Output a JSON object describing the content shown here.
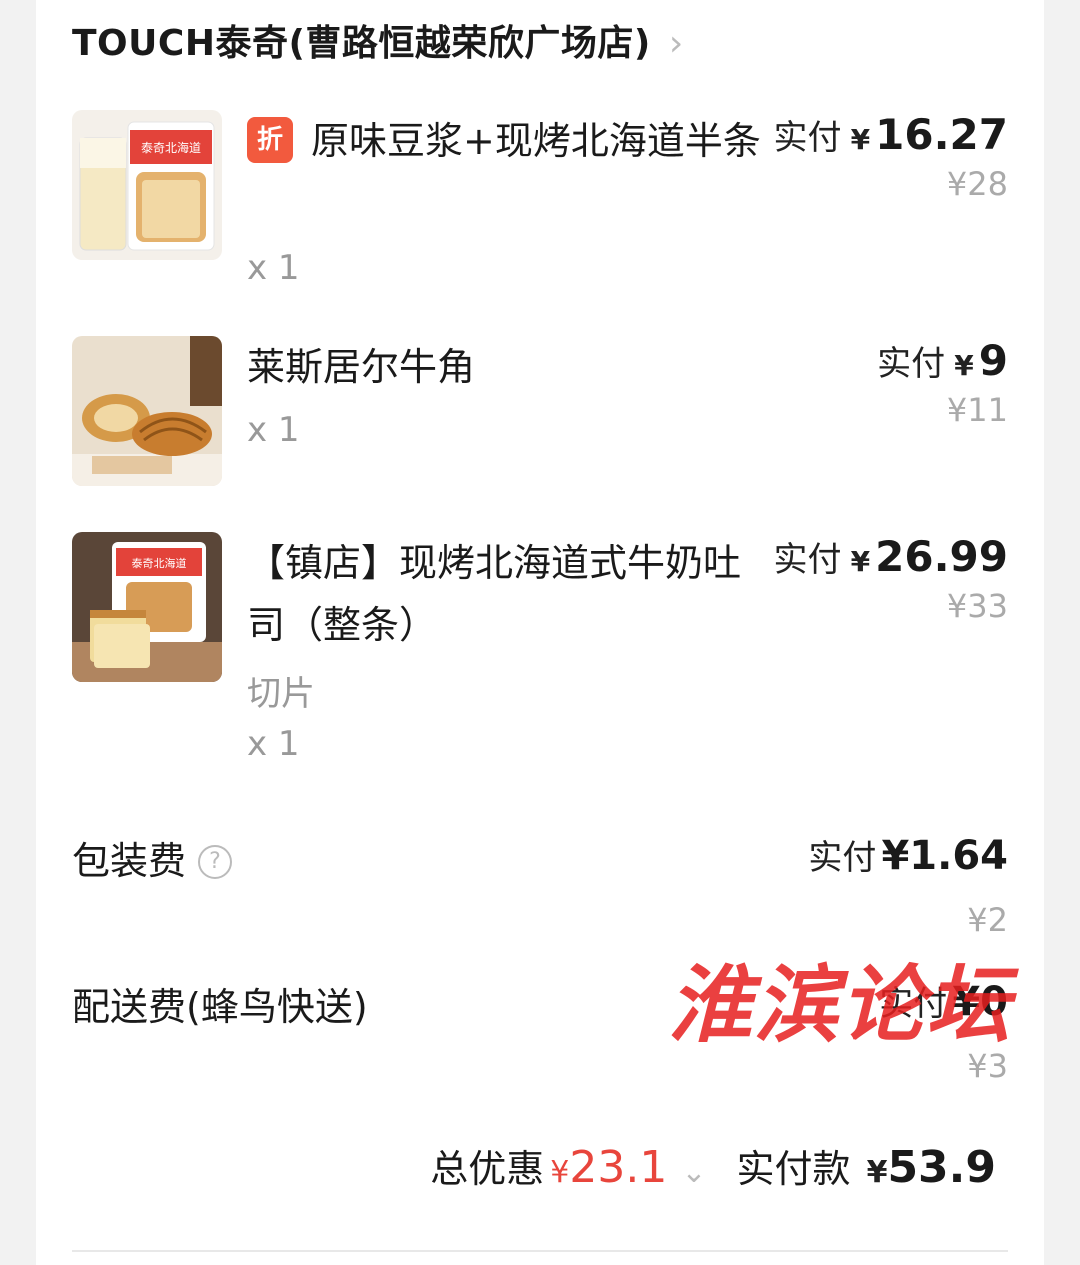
{
  "store": {
    "name": "TOUCH泰奇(曹路恒越荣欣广场店)",
    "chevron": "›"
  },
  "labels": {
    "paid": "实付",
    "currency": "¥",
    "discount_badge": "折"
  },
  "items": [
    {
      "name": "原味豆浆+现烤北海道半条",
      "qty": "x 1",
      "paid": "16.27",
      "original": "¥28",
      "has_discount": true,
      "spec": ""
    },
    {
      "name": "莱斯居尔牛角",
      "qty": "x 1",
      "paid": "9",
      "original": "¥11",
      "has_discount": false,
      "spec": ""
    },
    {
      "name": "【镇店】现烤北海道式牛奶吐司（整条）",
      "qty": "x 1",
      "paid": "26.99",
      "original": "¥33",
      "has_discount": false,
      "spec": "切片"
    }
  ],
  "fees": [
    {
      "label": "包装费",
      "paid_label": "实付",
      "paid": "¥1.64",
      "original": "¥2",
      "help": "?"
    },
    {
      "label": "配送费(蜂鸟快送)",
      "paid_label": "实付",
      "paid": "¥0",
      "original": "¥3"
    }
  ],
  "summary": {
    "discount_label": "总优惠",
    "discount_currency": "¥",
    "discount_value": "23.1",
    "total_label": "实付款",
    "total_currency": "¥",
    "total_value": "53.9"
  },
  "watermark": "淮滨论坛",
  "colors": {
    "accent_red": "#e8453c",
    "badge": "#f25a3e"
  }
}
